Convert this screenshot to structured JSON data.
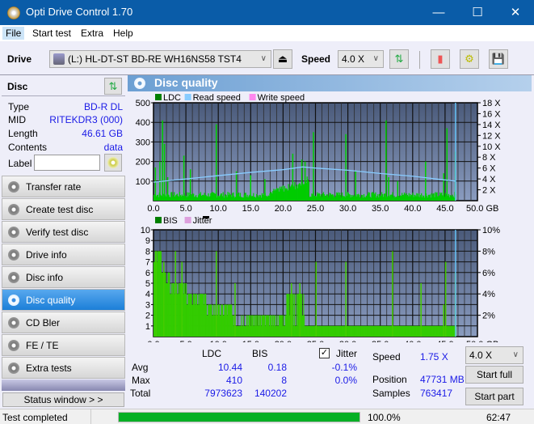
{
  "window": {
    "title": "Opti Drive Control 1.70",
    "minimize": "—",
    "maximize": "☐",
    "close": "✕"
  },
  "menu": [
    "File",
    "Start test",
    "Extra",
    "Help"
  ],
  "toolbar": {
    "drive_label": "Drive",
    "drive_value": "(L:)  HL-DT-ST BD-RE  WH16NS58 TST4",
    "speed_label": "Speed",
    "speed_value": "4.0 X"
  },
  "disc": {
    "header": "Disc",
    "rows": [
      {
        "k": "Type",
        "v": "BD-R DL"
      },
      {
        "k": "MID",
        "v": "RITEKDR3 (000)"
      },
      {
        "k": "Length",
        "v": "46.61 GB"
      },
      {
        "k": "Contents",
        "v": "data"
      }
    ],
    "label_caption": "Label",
    "label_value": ""
  },
  "nav": [
    "Transfer rate",
    "Create test disc",
    "Verify test disc",
    "Drive info",
    "Disc info",
    "Disc quality",
    "CD Bler",
    "FE / TE",
    "Extra tests"
  ],
  "nav_active": 5,
  "status_window_label": "Status window > >",
  "panel_title": "Disc quality",
  "chart_data": [
    {
      "type": "bar",
      "title": "LDC",
      "legend": [
        "LDC",
        "Read speed",
        "Write speed"
      ],
      "legend_colors": [
        "#008000",
        "#88ccff",
        "#ff88ee"
      ],
      "xlabel": "GB",
      "xlim": [
        0,
        50
      ],
      "xticks": [
        "0.0",
        "5.0",
        "10.0",
        "15.0",
        "20.0",
        "25.0",
        "30.0",
        "35.0",
        "40.0",
        "45.0",
        "50.0 GB"
      ],
      "ylim": [
        0,
        500
      ],
      "yticks": [
        "100",
        "200",
        "300",
        "400",
        "500"
      ],
      "y2ticks": [
        "2 X",
        "4 X",
        "6 X",
        "8 X",
        "10 X",
        "12 X",
        "14 X",
        "16 X",
        "18 X"
      ],
      "y2lim": [
        0,
        18
      ],
      "disc_end_gb": 46.61,
      "ldc_peaks": [
        [
          0.2,
          170
        ],
        [
          0.9,
          200
        ],
        [
          1.3,
          410
        ],
        [
          1.6,
          290
        ],
        [
          2.1,
          120
        ],
        [
          4.6,
          230
        ],
        [
          5.6,
          160
        ],
        [
          9.6,
          390
        ],
        [
          12.7,
          150
        ],
        [
          14.9,
          130
        ],
        [
          17.1,
          110
        ],
        [
          21.4,
          240
        ],
        [
          22.8,
          210
        ],
        [
          23.3,
          200
        ],
        [
          24.6,
          350
        ],
        [
          29.6,
          340
        ],
        [
          31.1,
          150
        ],
        [
          35.8,
          410
        ],
        [
          36.2,
          120
        ],
        [
          37.6,
          100
        ],
        [
          41.9,
          200
        ],
        [
          44.7,
          140
        ],
        [
          45.2,
          370
        ],
        [
          46.5,
          250
        ]
      ],
      "ldc_baseline": 30,
      "read_speed": [
        [
          0,
          3.4
        ],
        [
          5,
          4.0
        ],
        [
          10,
          4.6
        ],
        [
          15,
          5.2
        ],
        [
          20,
          5.7
        ],
        [
          23,
          6.2
        ],
        [
          25,
          6.0
        ],
        [
          30,
          5.6
        ],
        [
          35,
          5.0
        ],
        [
          40,
          4.5
        ],
        [
          45,
          3.8
        ],
        [
          46.6,
          3.6
        ]
      ]
    },
    {
      "type": "bar",
      "title": "BIS",
      "legend": [
        "BIS",
        "Jitter"
      ],
      "legend_colors": [
        "#008000",
        "#dda0dd"
      ],
      "xlabel": "GB",
      "xlim": [
        0,
        50
      ],
      "xticks": [
        "0.0",
        "5.0",
        "10.0",
        "15.0",
        "20.0",
        "25.0",
        "30.0",
        "35.0",
        "40.0",
        "45.0",
        "50.0 GB"
      ],
      "ylim": [
        0,
        10
      ],
      "yticks": [
        "1",
        "2",
        "3",
        "4",
        "5",
        "6",
        "7",
        "8",
        "9",
        "10"
      ],
      "y2ticks": [
        "2%",
        "4%",
        "6%",
        "8%",
        "10%"
      ],
      "y2lim": [
        0,
        10
      ],
      "bis_levels": [
        [
          0,
          8
        ],
        [
          1.2,
          6
        ],
        [
          2.5,
          5
        ],
        [
          5,
          4
        ],
        [
          7,
          4
        ],
        [
          8,
          3
        ],
        [
          12,
          2
        ],
        [
          23.5,
          1
        ],
        [
          46.6,
          1
        ]
      ],
      "bis_peaks": [
        [
          0.3,
          8
        ],
        [
          1.5,
          7
        ],
        [
          3.3,
          8
        ],
        [
          4.3,
          7
        ],
        [
          9.6,
          8
        ],
        [
          12.5,
          5
        ],
        [
          21.2,
          5
        ],
        [
          22.5,
          5
        ],
        [
          25,
          7
        ],
        [
          29.6,
          7
        ],
        [
          36.8,
          8
        ],
        [
          41.2,
          5
        ],
        [
          44.7,
          3
        ],
        [
          45,
          7
        ],
        [
          46.5,
          6
        ]
      ]
    }
  ],
  "stats": {
    "col_ldc": "LDC",
    "col_bis": "BIS",
    "jitter_label": "Jitter",
    "jitter_checked": true,
    "rows": [
      {
        "label": "Avg",
        "ldc": "10.44",
        "bis": "0.18",
        "jitter": "-0.1%"
      },
      {
        "label": "Max",
        "ldc": "410",
        "bis": "8",
        "jitter": "0.0%"
      },
      {
        "label": "Total",
        "ldc": "7973623",
        "bis": "140202",
        "jitter": ""
      }
    ],
    "speed_label": "Speed",
    "speed_value": "1.75 X",
    "position_label": "Position",
    "position_value": "47731 MB",
    "samples_label": "Samples",
    "samples_value": "763417",
    "speed_select": "4.0 X",
    "start_full": "Start full",
    "start_part": "Start part"
  },
  "statusbar": {
    "text": "Test completed",
    "progress": 100.0,
    "progress_text": "100.0%",
    "time": "62:47"
  }
}
